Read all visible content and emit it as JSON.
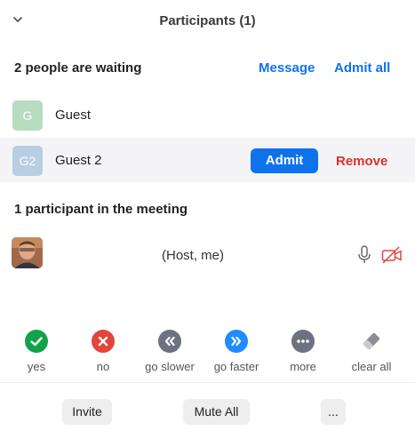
{
  "header": {
    "title": "Participants (1)",
    "collapse_icon": "chevron-down-icon"
  },
  "waiting": {
    "title": "2 people are waiting",
    "message_label": "Message",
    "admit_all_label": "Admit all",
    "people": [
      {
        "initials": "G",
        "name": "Guest",
        "avatar_color": "#b8dcc0"
      },
      {
        "initials": "G2",
        "name": "Guest 2",
        "avatar_color": "#b9cde3"
      }
    ],
    "admit_label": "Admit",
    "remove_label": "Remove"
  },
  "meeting": {
    "title": "1 participant in the meeting",
    "host_label": "(Host, me)",
    "icons": [
      "microphone-icon",
      "video-off-icon"
    ]
  },
  "reactions": [
    {
      "label": "yes",
      "icon": "check-circle-icon",
      "color": "#12a34a"
    },
    {
      "label": "no",
      "icon": "x-circle-icon",
      "color": "#e0463b"
    },
    {
      "label": "go slower",
      "icon": "rewind-icon",
      "color": "#6e7280"
    },
    {
      "label": "go faster",
      "icon": "fast-forward-icon",
      "color": "#1f8cff"
    },
    {
      "label": "more",
      "icon": "more-dots-icon",
      "color": "#6e7280"
    },
    {
      "label": "clear all",
      "icon": "eraser-icon",
      "color": "#8a8d94"
    }
  ],
  "footer": {
    "invite_label": "Invite",
    "mute_all_label": "Mute All",
    "more_label": "..."
  },
  "colors": {
    "accent": "#0e72ed",
    "danger": "#d9312e",
    "row_highlight": "#f4f4f6"
  }
}
